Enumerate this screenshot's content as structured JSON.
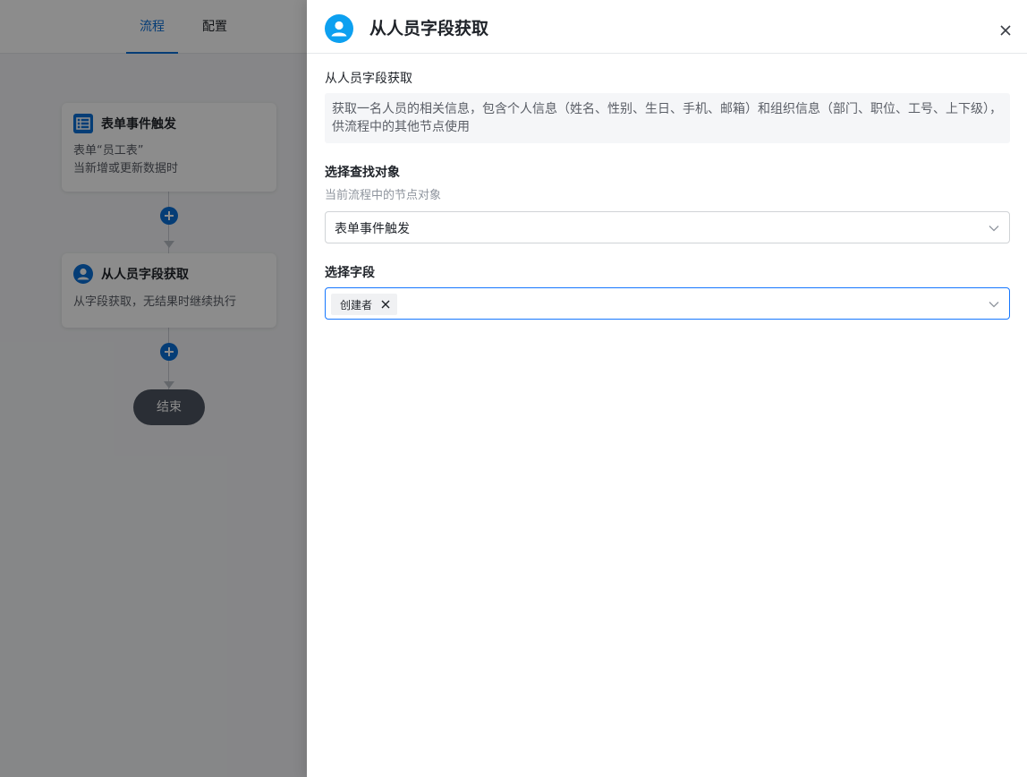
{
  "tabs": [
    {
      "label": "流程",
      "active": true
    },
    {
      "label": "配置",
      "active": false
    }
  ],
  "flow": {
    "trigger_node": {
      "title": "表单事件触发",
      "line1": "表单“员工表”",
      "line2": "当新增或更新数据时",
      "icon": "table-icon"
    },
    "person_node": {
      "title": "从人员字段获取",
      "desc": "从字段获取，无结果时继续执行",
      "icon": "user-icon"
    },
    "end_label": "结束"
  },
  "drawer": {
    "title": "从人员字段获取",
    "icon": "user-avatar-icon",
    "desc_title": "从人员字段获取",
    "desc_text": "获取一名人员的相关信息，包含个人信息（姓名、性别、生日、手机、邮箱）和组织信息（部门、职位、工号、上下级），供流程中的其他节点使用",
    "target_label": "选择查找对象",
    "target_hint": "当前流程中的节点对象",
    "target_value": "表单事件触发",
    "field_label": "选择字段",
    "field_tag": "创建者"
  },
  "colors": {
    "accent": "#0a6fd8",
    "avatar": "#0da0f0",
    "focus_border": "#1677ff"
  }
}
